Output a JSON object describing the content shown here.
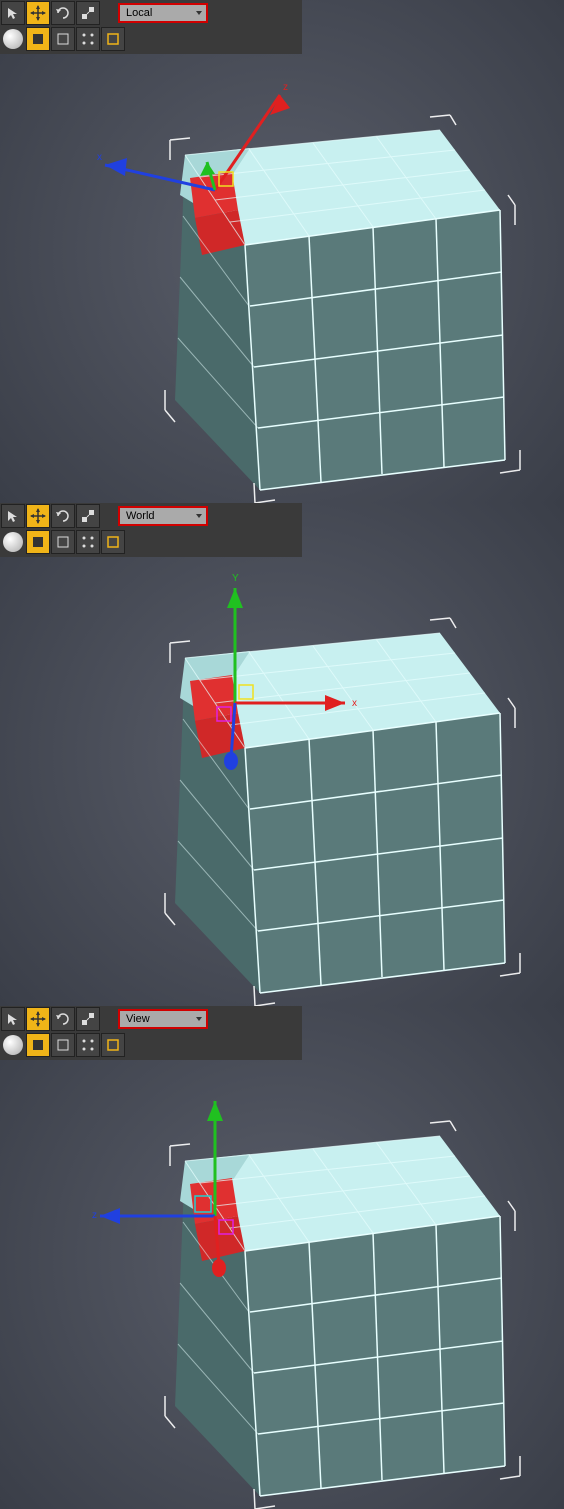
{
  "panels": [
    {
      "orient_label": "Local"
    },
    {
      "orient_label": "World"
    },
    {
      "orient_label": "View"
    }
  ],
  "axis": {
    "x": "x",
    "y": "y",
    "z": "z",
    "Y": "Y"
  },
  "colors": {
    "accent": "#f0b418",
    "highlight_border": "#d00000",
    "axis_x": "#e02020",
    "axis_y": "#20c020",
    "axis_z": "#2040e0",
    "cube_top": "#c8f0f0",
    "cube_side": "#5a7a7a",
    "cube_line": "#e8ffff",
    "selected_face": "#e03030"
  }
}
